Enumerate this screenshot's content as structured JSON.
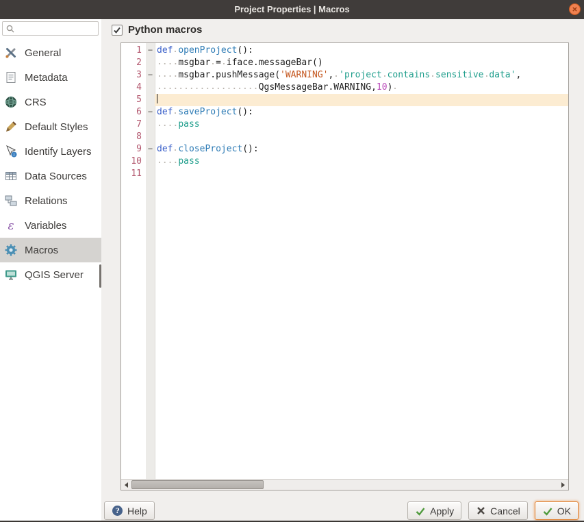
{
  "window": {
    "title": "Project Properties | Macros"
  },
  "sidebar": {
    "items": [
      {
        "label": "General",
        "icon": "general-icon"
      },
      {
        "label": "Metadata",
        "icon": "metadata-icon"
      },
      {
        "label": "CRS",
        "icon": "crs-icon"
      },
      {
        "label": "Default Styles",
        "icon": "styles-icon"
      },
      {
        "label": "Identify Layers",
        "icon": "identify-icon"
      },
      {
        "label": "Data Sources",
        "icon": "datasources-icon"
      },
      {
        "label": "Relations",
        "icon": "relations-icon"
      },
      {
        "label": "Variables",
        "icon": "variables-icon"
      },
      {
        "label": "Macros",
        "icon": "macros-icon",
        "selected": true
      },
      {
        "label": "QGIS Server",
        "icon": "server-icon"
      }
    ]
  },
  "main": {
    "python_macros_label": "Python macros",
    "python_macros_checked": true
  },
  "editor": {
    "current_line": 5,
    "fold_marker_glyph": "−",
    "lines": [
      {
        "num": "1",
        "fold": true,
        "tokens": [
          [
            "def",
            "kw"
          ],
          [
            " ",
            "sp"
          ],
          [
            "openProject",
            "fn"
          ],
          [
            "():",
            "tx"
          ]
        ]
      },
      {
        "num": "2",
        "fold": false,
        "tokens": [
          [
            "    ",
            "sp"
          ],
          [
            "msgbar",
            "tx"
          ],
          [
            " ",
            "sp"
          ],
          [
            "=",
            "tx"
          ],
          [
            " ",
            "sp"
          ],
          [
            "iface.messageBar()",
            "tx"
          ]
        ]
      },
      {
        "num": "3",
        "fold": true,
        "tokens": [
          [
            "    ",
            "sp"
          ],
          [
            "msgbar.pushMessage(",
            "tx"
          ],
          [
            "'WARNING'",
            "str"
          ],
          [
            ",",
            "tx"
          ],
          [
            " ",
            "sp"
          ],
          [
            "'project",
            "teal"
          ],
          [
            " ",
            "sp"
          ],
          [
            "contains",
            "teal"
          ],
          [
            " ",
            "sp"
          ],
          [
            "sensitive",
            "teal"
          ],
          [
            " ",
            "sp"
          ],
          [
            "data'",
            "teal"
          ],
          [
            ",",
            "tx"
          ]
        ]
      },
      {
        "num": "4",
        "fold": false,
        "tokens": [
          [
            "                   ",
            "sp"
          ],
          [
            "QgsMessageBar.WARNING,",
            "tx"
          ],
          [
            "10",
            "num"
          ],
          [
            ")",
            "tx"
          ],
          [
            " ",
            "sp"
          ]
        ]
      },
      {
        "num": "5",
        "fold": false,
        "tokens": []
      },
      {
        "num": "6",
        "fold": true,
        "tokens": [
          [
            "def",
            "kw"
          ],
          [
            " ",
            "sp"
          ],
          [
            "saveProject",
            "fn"
          ],
          [
            "():",
            "tx"
          ]
        ]
      },
      {
        "num": "7",
        "fold": false,
        "tokens": [
          [
            "    ",
            "sp"
          ],
          [
            "pass",
            "teal"
          ]
        ]
      },
      {
        "num": "8",
        "fold": false,
        "tokens": []
      },
      {
        "num": "9",
        "fold": true,
        "tokens": [
          [
            "def",
            "kw"
          ],
          [
            " ",
            "sp"
          ],
          [
            "closeProject",
            "fn"
          ],
          [
            "():",
            "tx"
          ]
        ]
      },
      {
        "num": "10",
        "fold": false,
        "tokens": [
          [
            "    ",
            "sp"
          ],
          [
            "pass",
            "teal"
          ]
        ]
      },
      {
        "num": "11",
        "fold": false,
        "tokens": []
      }
    ]
  },
  "buttons": {
    "help": "Help",
    "apply": "Apply",
    "cancel": "Cancel",
    "ok": "OK"
  },
  "colors": {
    "titlebar_bg": "#403c3a",
    "close_button": "#f08150",
    "dialog_bg": "#f1efed",
    "sidebar_selected_bg": "#d5d3d0",
    "editor_current_line": "#fcecd2",
    "code_keyword": "#3a5fc9",
    "code_function": "#2d7bb5",
    "code_string_orange": "#c4561e",
    "code_string_teal": "#1f9e8c",
    "code_number": "#b94ab9",
    "line_number": "#b2566d",
    "ok_focus_border": "#e0812f"
  }
}
